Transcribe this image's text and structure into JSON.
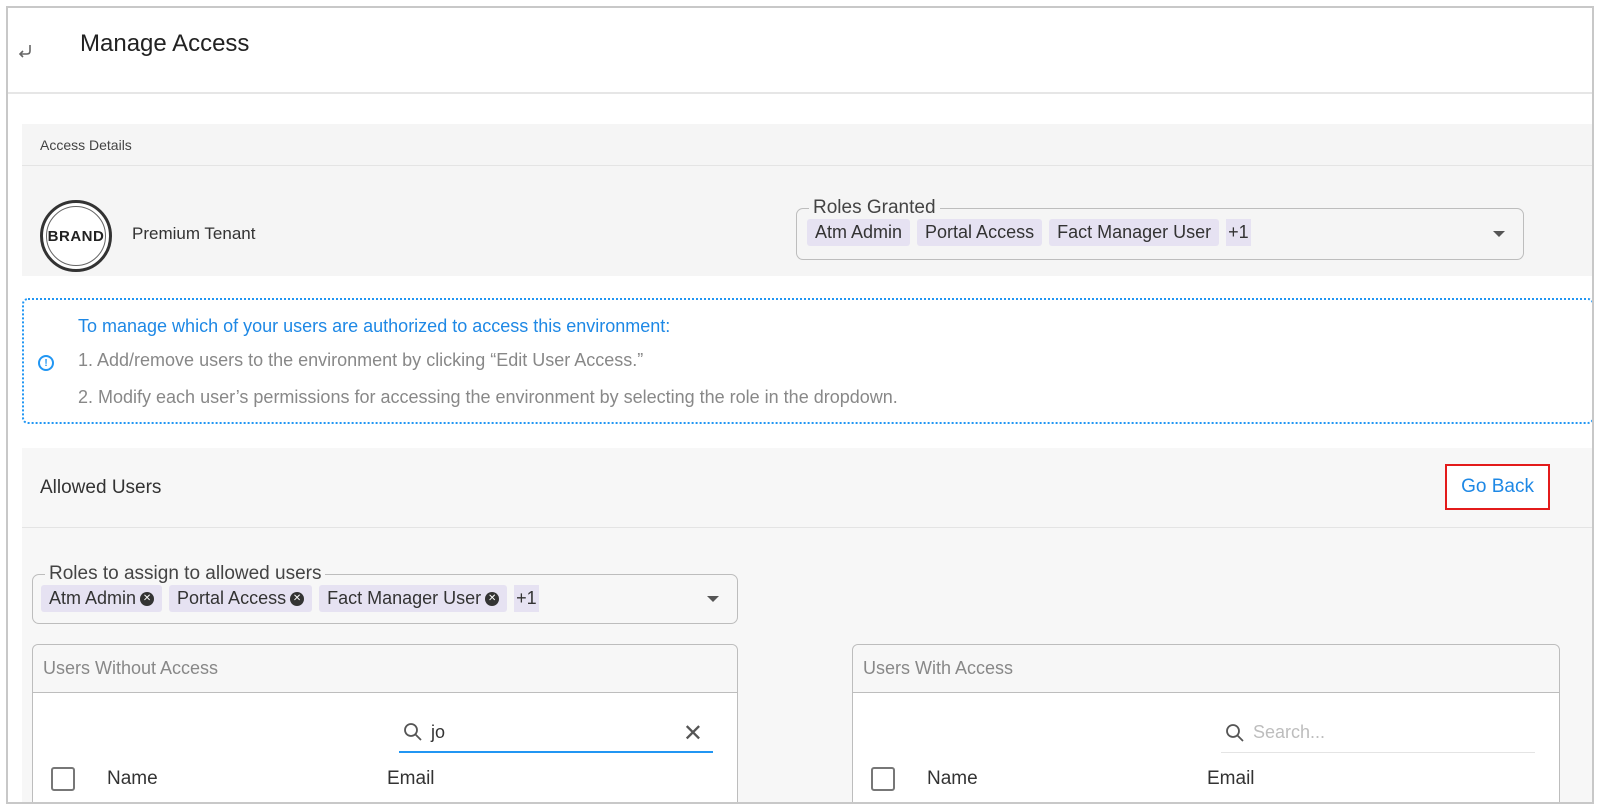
{
  "header": {
    "title": "Manage Access",
    "back_icon": "return-arrow-icon"
  },
  "access_details": {
    "heading": "Access Details",
    "tenant_name": "Premium Tenant",
    "logo_text": "BRAND",
    "roles_granted": {
      "label": "Roles Granted",
      "chips": [
        "Atm Admin",
        "Portal Access",
        "Fact Manager User"
      ],
      "more": "+1"
    }
  },
  "info": {
    "title": "To manage which of your users are authorized to access this environment:",
    "lines": [
      "1. Add/remove users to the environment by clicking “Edit User Access.”",
      "2. Modify each user’s permissions for accessing the environment by selecting the role in the dropdown."
    ]
  },
  "allowed_users": {
    "heading": "Allowed Users",
    "go_back_label": "Go Back",
    "roles_to_assign": {
      "label": "Roles to assign to allowed users",
      "chips": [
        "Atm Admin",
        "Portal Access",
        "Fact Manager User"
      ],
      "more": "+1"
    },
    "without_access": {
      "title": "Users Without Access",
      "search_value": "jo",
      "columns": {
        "name": "Name",
        "email": "Email"
      }
    },
    "with_access": {
      "title": "Users With Access",
      "search_placeholder": "Search...",
      "columns": {
        "name": "Name",
        "email": "Email"
      }
    }
  },
  "colors": {
    "accent_blue": "#1e88e5",
    "chip_bg": "#e6e2f2",
    "highlight_red": "#e31b1b"
  }
}
